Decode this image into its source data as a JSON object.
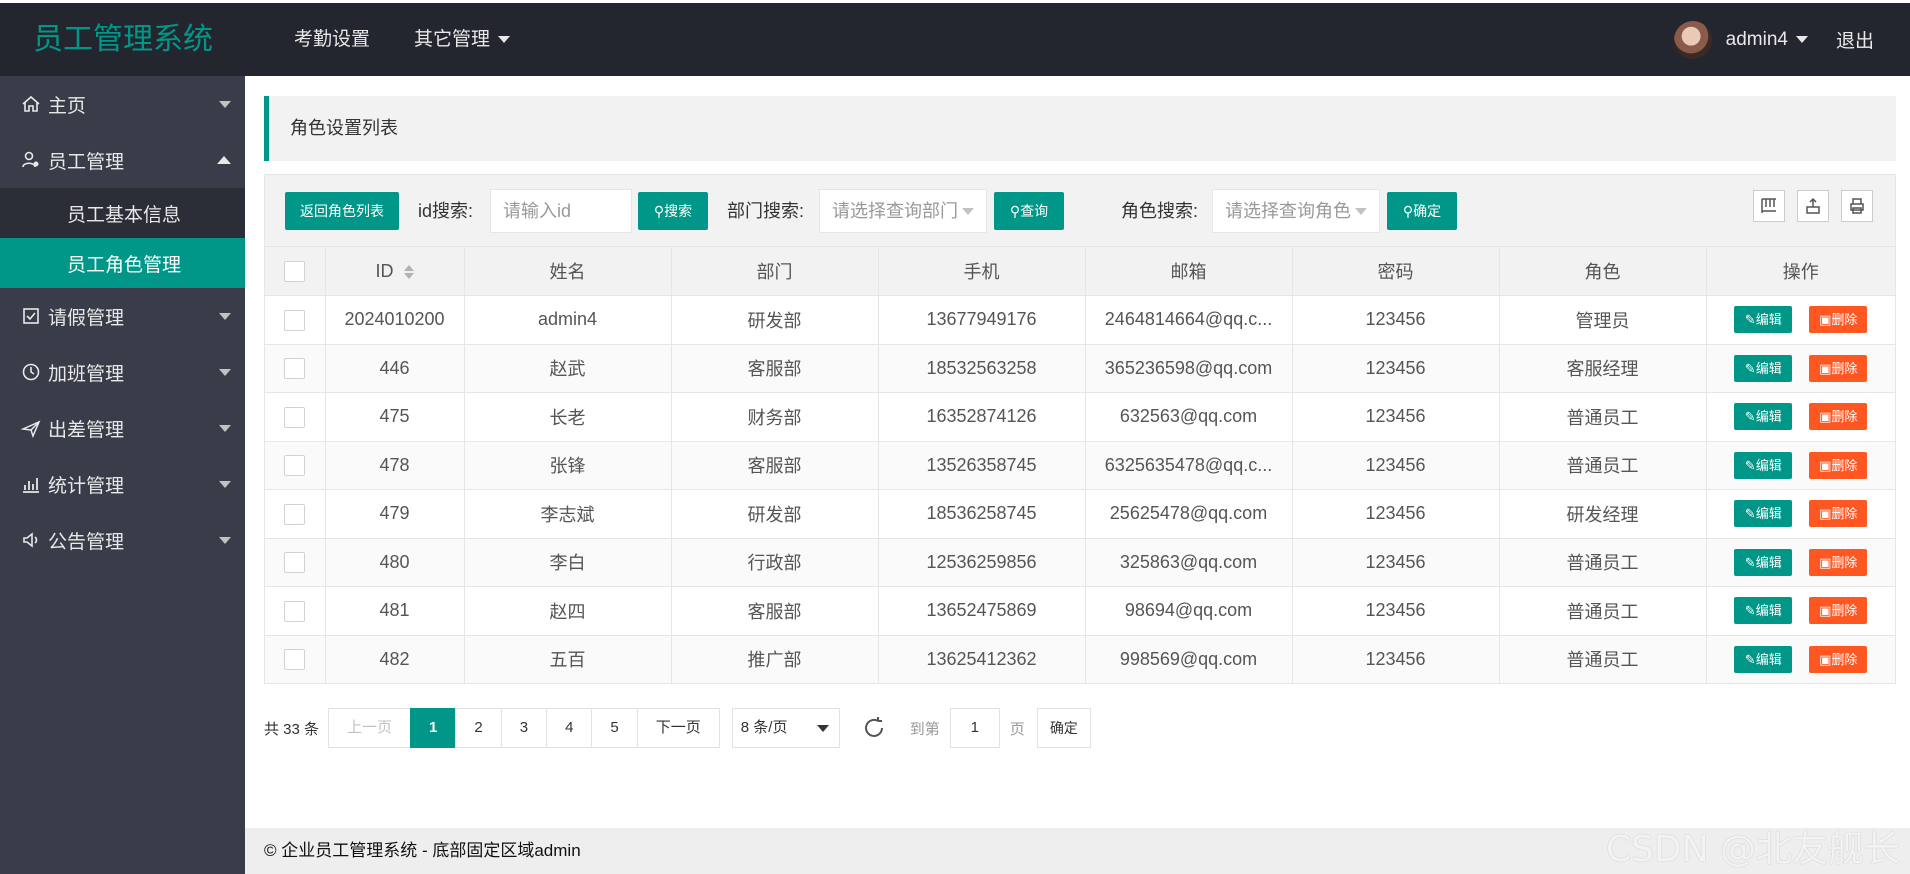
{
  "app": {
    "title": "员工管理系统"
  },
  "topnav": {
    "items": [
      {
        "label": "考勤设置"
      },
      {
        "label": "其它管理"
      }
    ]
  },
  "user": {
    "name": "admin4",
    "logout": "退出"
  },
  "sidebar": {
    "items": [
      {
        "label": "主页",
        "icon": "home-icon"
      },
      {
        "label": "员工管理",
        "icon": "user-manage-icon",
        "expanded": true,
        "children": [
          {
            "label": "员工基本信息"
          },
          {
            "label": "员工角色管理",
            "active": true
          }
        ]
      },
      {
        "label": "请假管理",
        "icon": "leave-icon"
      },
      {
        "label": "加班管理",
        "icon": "overtime-icon"
      },
      {
        "label": "出差管理",
        "icon": "plane-icon"
      },
      {
        "label": "统计管理",
        "icon": "stats-icon"
      },
      {
        "label": "公告管理",
        "icon": "speaker-icon"
      }
    ]
  },
  "page": {
    "title": "角色设置列表"
  },
  "toolbar": {
    "back_button": "返回角色列表",
    "id_label": "id搜索:",
    "id_placeholder": "请输入id",
    "id_search_button": "搜索",
    "dept_label": "部门搜索:",
    "dept_placeholder": "请选择查询部门",
    "dept_query_button": "查询",
    "role_label": "角色搜索:",
    "role_placeholder": "请选择查询角色",
    "role_confirm_button": "确定"
  },
  "table": {
    "columns": [
      "ID",
      "姓名",
      "部门",
      "手机",
      "邮箱",
      "密码",
      "角色",
      "操作"
    ],
    "edit_label": "编辑",
    "delete_label": "删除",
    "rows": [
      {
        "id": "2024010200",
        "name": "admin4",
        "dept": "研发部",
        "phone": "13677949176",
        "email": "2464814664@qq.c...",
        "password": "123456",
        "role": "管理员"
      },
      {
        "id": "446",
        "name": "赵武",
        "dept": "客服部",
        "phone": "18532563258",
        "email": "365236598@qq.com",
        "password": "123456",
        "role": "客服经理"
      },
      {
        "id": "475",
        "name": "长老",
        "dept": "财务部",
        "phone": "16352874126",
        "email": "632563@qq.com",
        "password": "123456",
        "role": "普通员工"
      },
      {
        "id": "478",
        "name": "张锋",
        "dept": "客服部",
        "phone": "13526358745",
        "email": "6325635478@qq.c...",
        "password": "123456",
        "role": "普通员工"
      },
      {
        "id": "479",
        "name": "李志斌",
        "dept": "研发部",
        "phone": "18536258745",
        "email": "25625478@qq.com",
        "password": "123456",
        "role": "研发经理"
      },
      {
        "id": "480",
        "name": "李白",
        "dept": "行政部",
        "phone": "12536259856",
        "email": "325863@qq.com",
        "password": "123456",
        "role": "普通员工"
      },
      {
        "id": "481",
        "name": "赵四",
        "dept": "客服部",
        "phone": "13652475869",
        "email": "98694@qq.com",
        "password": "123456",
        "role": "普通员工"
      },
      {
        "id": "482",
        "name": "五百",
        "dept": "推广部",
        "phone": "13625412362",
        "email": "998569@qq.com",
        "password": "123456",
        "role": "普通员工"
      }
    ]
  },
  "pagination": {
    "total": "共 33 条",
    "prev": "上一页",
    "pages": [
      "1",
      "2",
      "3",
      "4",
      "5"
    ],
    "current": "1",
    "next": "下一页",
    "page_size": "8 条/页",
    "goto_label": "到第",
    "goto_value": "1",
    "page_unit": "页",
    "goto_confirm": "确定"
  },
  "footer": {
    "text": "© 企业员工管理系统 - 底部固定区域admin"
  },
  "watermark": "CSDN @北友舰长",
  "colors": {
    "accent": "#009688",
    "danger": "#ff5722",
    "header_bg": "#23262e",
    "sidebar_bg": "#393d49"
  }
}
